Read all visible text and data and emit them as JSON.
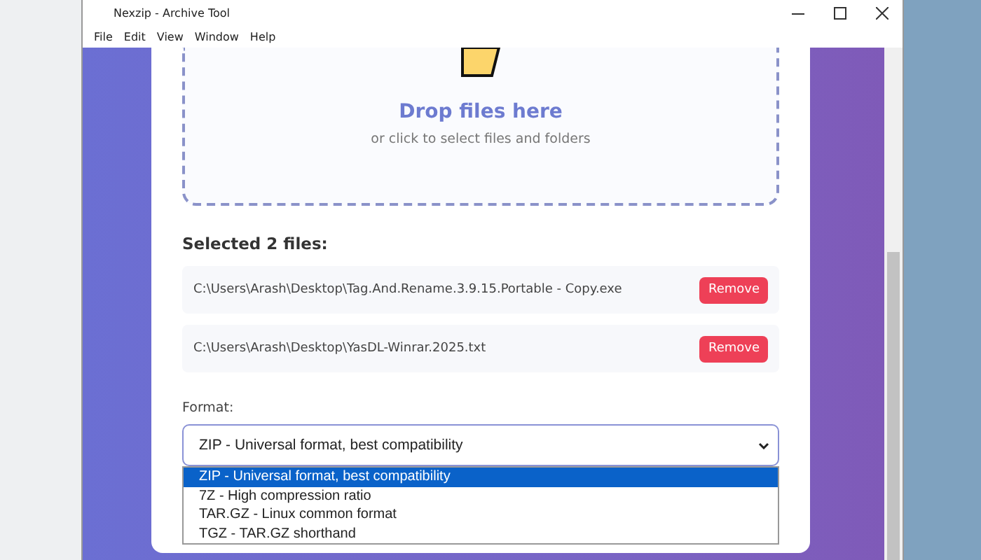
{
  "window": {
    "title": "Nexzip - Archive Tool"
  },
  "menu": [
    "File",
    "Edit",
    "View",
    "Window",
    "Help"
  ],
  "dropzone": {
    "title": "Drop files here",
    "subtitle": "or click to select files and folders"
  },
  "selected_heading": "Selected 2 files:",
  "files": [
    {
      "path": "C:\\Users\\Arash\\Desktop\\Tag.And.Rename.3.9.15.Portable - Copy.exe",
      "button": "Remove"
    },
    {
      "path": "C:\\Users\\Arash\\Desktop\\YasDL-Winrar.2025.txt",
      "button": "Remove"
    }
  ],
  "format": {
    "label": "Format:",
    "value": "ZIP - Universal format, best compatibility",
    "expanded": true,
    "options": [
      {
        "label": "ZIP - Universal format, best compatibility",
        "selected": true
      },
      {
        "label": "7Z - High compression ratio",
        "selected": false
      },
      {
        "label": "TAR.GZ - Linux common format",
        "selected": false
      },
      {
        "label": "TGZ - TAR.GZ shorthand",
        "selected": false
      }
    ]
  }
}
